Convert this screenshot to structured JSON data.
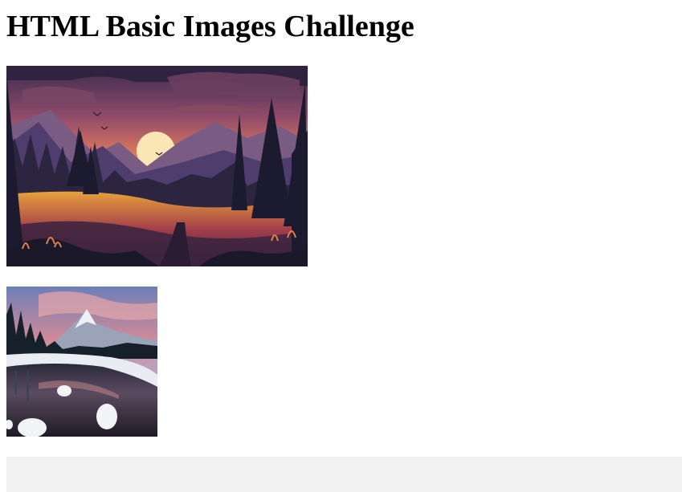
{
  "page": {
    "heading": "HTML Basic Images Challenge"
  },
  "images": [
    {
      "name": "sunset-landscape-illustration"
    },
    {
      "name": "snowy-mountain-lake-photo"
    }
  ],
  "colors": {
    "background": "#ffffff",
    "footer_bar": "#f1f1f2",
    "heading_text": "#000000"
  }
}
